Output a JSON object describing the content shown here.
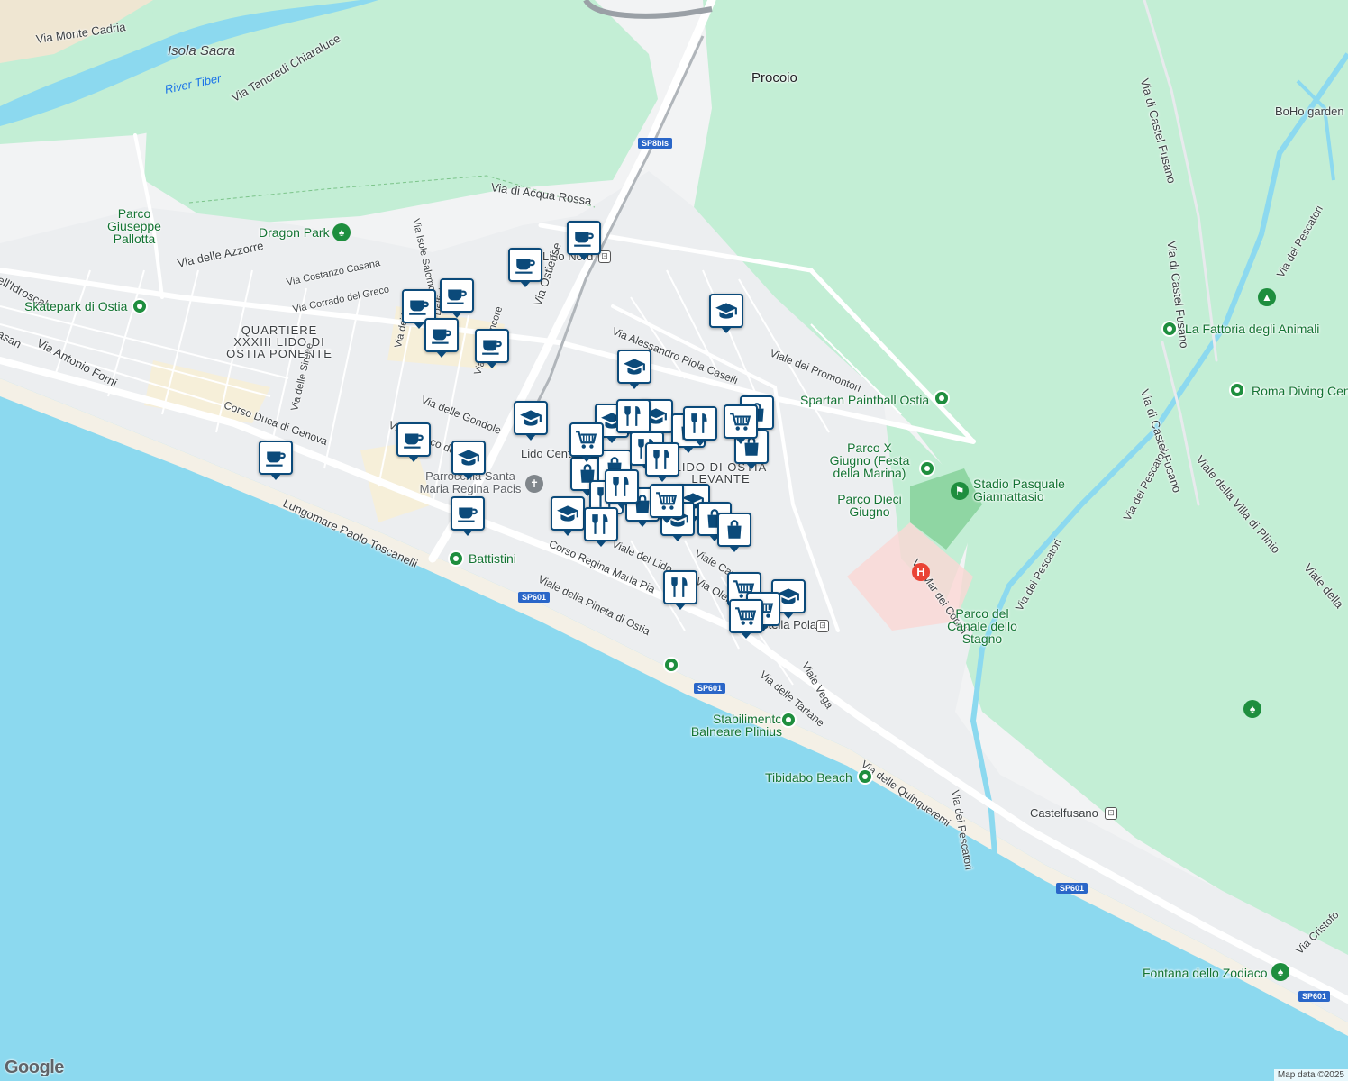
{
  "map": {
    "attribution": "Map data ©2025",
    "logo": "Google",
    "colors": {
      "water": "#8cd9ef",
      "park": "#c3eed5",
      "land": "#f2f3f4",
      "road": "#ffffff",
      "pin_border": "#0b4a7a",
      "poi_green": "#1e8e3e"
    }
  },
  "labels": {
    "via_monte_cadria": "Via Monte Cadria",
    "isola_sacra": "Isola Sacra",
    "river_tiber": "River Tiber",
    "via_tancredi_chiaraluce": "Via Tancredi Chiaraluce",
    "procoio": "Procoio",
    "via_di_castel_fusano_1": "Via di Castel Fusano",
    "via_di_castel_fusano_2": "Via di Castel Fusano",
    "via_di_castel_fusano_3": "Via di Castel Fusano",
    "boho_garden": "BoHo garden",
    "via_di_acqua_rossa": "Via di Acqua Rossa",
    "parco_pallotta": "Parco Giuseppe Pallotta",
    "dragon_park": "Dragon Park",
    "via_delle_azzorre": "Via delle Azzorre",
    "via_costanzo_casana": "Via Costanzo Casana",
    "via_corrado_del_greco": "Via Corrado del Greco",
    "via_isole_salomone": "Via Isole Salomone",
    "via_idroscalo": "ell'Idroscalo",
    "skatepark": "Skatepark di Ostia",
    "quartiere": "QUARTIERE XXXIII LIDO DI OSTIA PONENTE",
    "via_antonio_forni": "Via Antonio Forni",
    "casan": "asan",
    "corso_duca_di_genova": "Corso Duca di Genova",
    "via_delle_sirene": "Via delle Sirene",
    "via_delle_gondole": "Via delle Gondole",
    "viale_vasco_de_gama": "Viale Vasco de Gama",
    "lungomare": "Lungomare Paolo Toscanelli",
    "lido_nord": "Lido Nord",
    "via_ostiense": "Via Ostiense",
    "via_alessandro_piola_caselli": "Via Alessandro Piola Caselli",
    "viale_dei_promontori": "Viale dei Promontori",
    "spartan_paintball": "Spartan Paintball Ostia",
    "la_fattoria": "La Fattoria degli Animali",
    "roma_diving": "Roma Diving Cent",
    "via_dei_pescatori_1": "Via dei Pescatori",
    "via_dei_pescatori_2": "Via dei Pescatori",
    "via_dei_pescatori_3": "Via dei Pescatori",
    "via_dei_pescatori_4": "Via dei Pescatori",
    "viale_villa_plinio": "Viale della Villa di Plinio",
    "viale_della": "Viale della",
    "parco_x_giugno": "Parco X Giugno (Festa della Marina)",
    "stadio": "Stadio Pasquale Giannattasio",
    "parco_dieci_giugno": "Parco Dieci Giugno",
    "via_mar_dei_coralli": "Via Mar dei Coralli",
    "parco_canale": "Parco del Canale dello Stagno",
    "lido_centro": "Lido Centro",
    "lido_levante": "LIDO DI OSTIA LEVANTE",
    "parrocchia": "Parrocchia Santa Maria Regina Pacis",
    "battistini": "Battistini",
    "corso_regina_maria_pia": "Corso Regina Maria Pia",
    "viale_del_lido": "Viale del Lido",
    "viale_capitan": "Viale Capitan",
    "via_olen": "Via Olen",
    "viale_pineta": "Viale della Pineta di Ostia",
    "stella_polare": "Stella Polare",
    "viale_vega": "Viale Vega",
    "via_delle_tartane": "Via delle Tartane",
    "via_quinqueremi": "Via delle Quinqueremi",
    "stabilimento": "Stabilimento Balneare Plinius",
    "tibidabo": "Tibidabo Beach",
    "castelfusano": "Castelfusano",
    "fontana": "Fontana dello Zodiaco",
    "via_cristoforo": "Via Cristofo",
    "via_dei_vel": "Via dei Vel",
    "via_dei_delfini": "Via dei Delfini",
    "via_delle_fragole": "Via delle Ancore"
  },
  "shields": {
    "sp8bis": "SP8bis",
    "sp601": "SP601"
  },
  "poi_icons": {
    "cafe": "cafe-icon",
    "school": "school-icon",
    "shopping": "shopping-bag-icon",
    "cart": "grocery-cart-icon",
    "restaurant": "restaurant-icon"
  }
}
